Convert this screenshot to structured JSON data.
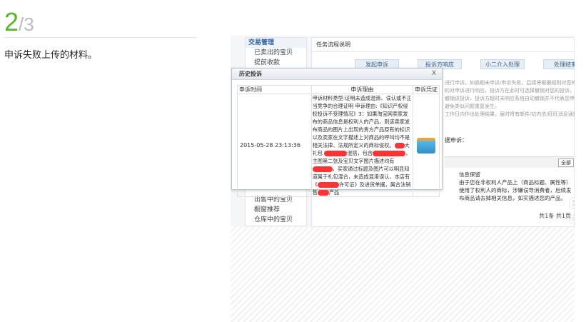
{
  "step": {
    "current": "2",
    "total": "/3"
  },
  "description": "申诉失败上传的材料。",
  "sidebar": {
    "header": "交易管理",
    "items_top": [
      "已卖出的宝贝",
      "提前收款"
    ],
    "items_bottom": [
      "出售中的宝贝",
      "橱窗推荐",
      "仓库中的宝贝"
    ]
  },
  "main": {
    "title": "任务流程说明",
    "steps": [
      "发起申诉",
      "投诉方响应",
      "小二介入处理",
      "处理结束"
    ],
    "bg_lines": [
      "进行申诉，如逾期未申诉/申诉失败，后续将根据规则对您的",
      "的对申诉进行响应，投诉方在此时可选择撤销对您的投诉，",
      "撤销该投诉，投诉方超时未响应系统自动撤销并不代表您申",
      "避免类似问题重复发生。",
      "工作日内作出处理结果，届时将有邮件/站内信/旺旺消息通知"
    ],
    "label": "据申诉：",
    "all_button": "全部",
    "info_title": "信息保留",
    "info_text": "由于您在非权利人产品上（商品标题、属性等）使用了权利人的商标，涉嫌误导消费者，后续发布商品请去掉相关信息，如实描述您的产品。",
    "pager": "共1条 共1页",
    "watermark": "Bai du 经验"
  },
  "dialog": {
    "title": "历史投诉",
    "close": "X",
    "columns": [
      "申诉时间",
      "申诉理由",
      "申诉凭证"
    ],
    "row": {
      "time": "2015-05-28 23:13:36",
      "reason_a": "申诉材料类型:证明未造成混淆、误认或不正当竞争的合理证明 申诉理由:《知识产权侵权投诉不受理情况》3：如果淘宝网卖家发布的商品信息是权利人的产品，则该卖家发布商品的图片上出现的贵方产品原有的标识以及卖家在文字描述上对商品的呼叫均不是相关法律、法规所定义的商标侵权。",
      "reason_b": "大礼包",
      "reason_c": "混搭，包含",
      "reason_d": "，主图第二张及宝贝文字图片描述均有",
      "reason_e": "，买家通过标题及图片可以明显知道属于礼包混合，未造成混淆误认，本店有《",
      "reason_f": "许可证》及进货单据，属合法销售",
      "reason_g": "产品"
    }
  }
}
